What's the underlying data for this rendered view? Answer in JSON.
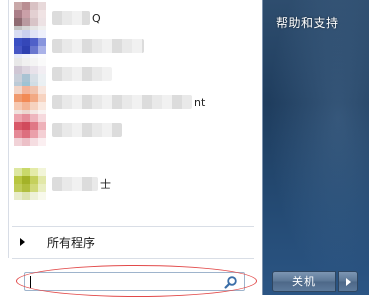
{
  "start_menu": {
    "help_and_support": "帮助和支持",
    "all_programs": "所有程序",
    "shutdown_label": "关机",
    "search": {
      "value": ""
    },
    "programs": [
      {
        "name_visible": "Q",
        "icon_colors": [
          "#c9a8a8",
          "#b98e92",
          "#d9c2c4",
          "#e8d9da",
          "#aa7e88",
          "#caa0a8",
          "#e3d0d2",
          "#f0e3e4",
          "#8f6b72",
          "#b99aa0",
          "#d8c4c7",
          "#ede2e4",
          "#c4c4c4",
          "#d7d7d7",
          "#e5e5e5",
          "#f0f0f0"
        ]
      },
      {
        "name_visible": "",
        "icon_colors": [
          "#d8dcf2",
          "#c9cfee",
          "#e1e4f6",
          "#eef0fb",
          "#3a4fc3",
          "#3547b8",
          "#5060c8",
          "#8895dd",
          "#4656c4",
          "#2e40b0",
          "#6a77cf",
          "#aab2e8",
          "#e6e9f8",
          "#f0f1fb",
          "#f6f7fc",
          "#fbfbfe"
        ]
      },
      {
        "name_visible": "",
        "icon_colors": [
          "#e8e8e8",
          "#f0f0f0",
          "#f4f4f4",
          "#fafafa",
          "#d0c7d4",
          "#dcd5df",
          "#e8e2ea",
          "#f2eef3",
          "#c9cfd9",
          "#a9c3d3",
          "#d7dfe6",
          "#ecf0f3",
          "#bccbd7",
          "#9dc3d4",
          "#d0dde5",
          "#eaf0f3"
        ]
      },
      {
        "name_visible": "nt",
        "has_submenu": true,
        "icon_colors": [
          "#f2d5c8",
          "#f3b49a",
          "#f0c3ae",
          "#f8e6de",
          "#f09a6e",
          "#f28a55",
          "#f2a984",
          "#f7d3c0",
          "#f6c9b2",
          "#f3b596",
          "#f6d2bf",
          "#fae9e0",
          "#f0e2de",
          "#ecd6d0",
          "#f4e8e4",
          "#faf4f2"
        ]
      },
      {
        "name_visible": "",
        "icon_colors": [
          "#eda3ad",
          "#e58e9b",
          "#eeb6be",
          "#f6d9dd",
          "#d95868",
          "#d14a5c",
          "#e07886",
          "#eeb1b9",
          "#e58996",
          "#dd6f7e",
          "#eaa0aa",
          "#f4cfd4",
          "#f1d2d7",
          "#ecc0c7",
          "#f5dde1",
          "#fbeff1"
        ]
      },
      {
        "name_visible": "士",
        "icon_colors": [
          "#dde7a0",
          "#c9d96a",
          "#e4eba8",
          "#f2f5d8",
          "#b8c640",
          "#a3b228",
          "#c5d05c",
          "#e2e8a8",
          "#c0cc58",
          "#b1be3e",
          "#d0d978",
          "#e9eec0",
          "#e8eccb",
          "#dde3b0",
          "#eef1d8",
          "#f8f9ec"
        ]
      }
    ]
  }
}
